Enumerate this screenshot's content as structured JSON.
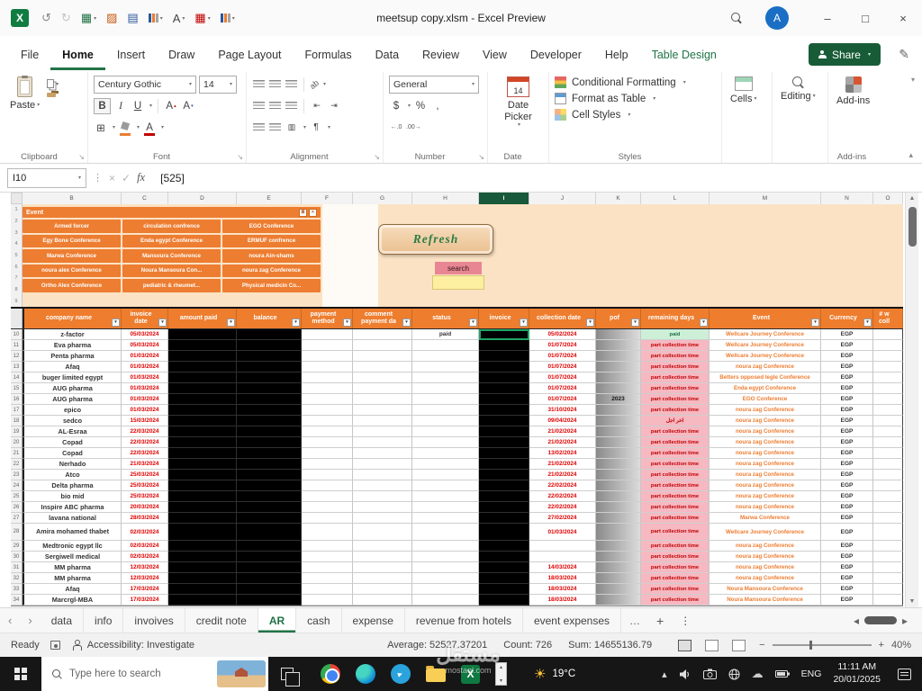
{
  "titlebar": {
    "title": "meetsup copy.xlsm - Excel Preview",
    "avatar_initial": "A",
    "qat": [
      {
        "id": "undo-icon",
        "caret": false
      },
      {
        "id": "redo-icon",
        "caret": false
      },
      {
        "id": "table-icon",
        "caret": true
      },
      {
        "id": "fill-icon",
        "caret": false
      },
      {
        "id": "grid-icon",
        "caret": false
      },
      {
        "id": "chart-icon",
        "caret": true
      },
      {
        "id": "font-icon",
        "caret": true
      },
      {
        "id": "calendar-icon",
        "caret": true
      },
      {
        "id": "chart-line-icon",
        "caret": true
      }
    ]
  },
  "ribbon": {
    "tabs": [
      "File",
      "Home",
      "Insert",
      "Draw",
      "Page Layout",
      "Formulas",
      "Data",
      "Review",
      "View",
      "Developer",
      "Help",
      "Table Design"
    ],
    "active_tab": "Home",
    "contextual_tab": "Table Design",
    "share_label": "Share",
    "paste_label": "Paste",
    "font_name": "Century Gothic",
    "font_size": "14",
    "number_format": "General",
    "calendar_day": "14",
    "date_picker_label": "Date Picker",
    "styles_buttons": [
      "Conditional Formatting",
      "Format as Table",
      "Cell Styles"
    ],
    "cells_label": "Cells",
    "editing_label": "Editing",
    "addins_label": "Add-ins",
    "group_labels": [
      "Clipboard",
      "Font",
      "Alignment",
      "Number",
      "Date",
      "Styles",
      "Add-ins"
    ]
  },
  "formula_bar": {
    "name_box": "I10",
    "value": "[525]"
  },
  "grid": {
    "column_letters": [
      "B",
      "C",
      "D",
      "E",
      "F",
      "G",
      "H",
      "I",
      "J",
      "K",
      "L",
      "M",
      "N",
      "O"
    ],
    "selected_letter": "I",
    "peach_row_numbers": [
      1,
      2,
      3,
      4,
      5,
      6,
      7,
      8,
      9
    ],
    "slicer": {
      "title": "Event",
      "items": [
        "Armed forcer",
        "circulation confrence",
        "EGO Conference",
        "Egy Bone Conference",
        "Enda egypt Conference",
        "ERMUF confrence",
        "Marwa Conference",
        "Mansoura Conference",
        "noura Ain-shams",
        "noura alex Conference",
        "Noura Mansoura Con...",
        "noura zag Conference",
        "Ortho Alex Conference",
        "pediatric & rheumet...",
        "Physical medicin Co..."
      ]
    },
    "refresh_label": "Refresh",
    "search_label": "search"
  },
  "table": {
    "headers": [
      "company name",
      "invoice date",
      "amount paid",
      "balance",
      "payment method",
      "comment payment da",
      "status",
      "invoice",
      "collection date",
      "pof",
      "remaining days",
      "Event",
      "Currency",
      "# w coll"
    ],
    "rows": [
      {
        "n": 10,
        "company": "z-factor",
        "date": "05/03/2024",
        "status": "paid",
        "coll": "05/02/2024",
        "pof": "",
        "rem": "paid",
        "rt": "g",
        "event": "Wellcare Journey Conference",
        "cur": "EGP",
        "sel": true
      },
      {
        "n": 11,
        "company": "Eva pharma",
        "date": "05/03/2024",
        "coll": "01/07/2024",
        "rem": "part collection time",
        "rt": "p",
        "event": "Wellcare Journey Conference",
        "cur": "EGP"
      },
      {
        "n": 12,
        "company": "Penta pharma",
        "date": "01/03/2024",
        "coll": "01/07/2024",
        "rem": "part collection time",
        "rt": "p",
        "event": "Wellcare Journey Conference",
        "cur": "EGP"
      },
      {
        "n": 13,
        "company": "Afaq",
        "date": "01/03/2024",
        "coll": "01/07/2024",
        "rem": "part collection time",
        "rt": "p",
        "event": "noura zag Conference",
        "cur": "EGP"
      },
      {
        "n": 14,
        "company": "buger limited egypt",
        "date": "01/03/2024",
        "coll": "01/07/2024",
        "rem": "part collection time",
        "rt": "p",
        "event": "Betters opposed legle Conference",
        "cur": "EGP"
      },
      {
        "n": 15,
        "company": "AUG pharma",
        "date": "01/03/2024",
        "coll": "01/07/2024",
        "rem": "part collection time",
        "rt": "p",
        "event": "Enda egypt Conference",
        "cur": "EGP"
      },
      {
        "n": 16,
        "company": "AUG pharma",
        "date": "01/03/2024",
        "coll": "01/07/2024",
        "pof": "2023",
        "rem": "part collection time",
        "rt": "p",
        "event": "EGO Conference",
        "cur": "EGP"
      },
      {
        "n": 17,
        "company": "epico",
        "date": "01/03/2024",
        "coll": "31/10/2024",
        "rem": "part collection time",
        "rt": "p",
        "event": "noura zag Conference",
        "cur": "EGP"
      },
      {
        "n": 18,
        "company": "sedco",
        "date": "15/03/2024",
        "coll": "09/04/2024",
        "rem": "اخر اجل",
        "rt": "p",
        "event": "noura zag Conference",
        "cur": "EGP"
      },
      {
        "n": 19,
        "company": "AL-Esraa",
        "date": "22/03/2024",
        "coll": "21/02/2024",
        "rem": "part collection time",
        "rt": "p",
        "event": "noura zag Conference",
        "cur": "EGP"
      },
      {
        "n": 20,
        "company": "Copad",
        "date": "22/03/2024",
        "coll": "21/02/2024",
        "rem": "part collection time",
        "rt": "p",
        "event": "noura zag Conference",
        "cur": "EGP"
      },
      {
        "n": 21,
        "company": "Copad",
        "date": "22/03/2024",
        "coll": "13/02/2024",
        "rem": "part collection time",
        "rt": "p",
        "event": "noura zag Conference",
        "cur": "EGP"
      },
      {
        "n": 22,
        "company": "Nerhado",
        "date": "21/03/2024",
        "coll": "21/02/2024",
        "rem": "part collection time",
        "rt": "p",
        "event": "noura zag Conference",
        "cur": "EGP"
      },
      {
        "n": 23,
        "company": "Atco",
        "date": "25/03/2024",
        "coll": "21/02/2024",
        "rem": "part collection time",
        "rt": "p",
        "event": "noura zag Conference",
        "cur": "EGP"
      },
      {
        "n": 24,
        "company": "Delta pharma",
        "date": "25/03/2024",
        "coll": "22/02/2024",
        "rem": "part collection time",
        "rt": "p",
        "event": "noura zag Conference",
        "cur": "EGP"
      },
      {
        "n": 25,
        "company": "bio mid",
        "date": "25/03/2024",
        "coll": "22/02/2024",
        "rem": "part collection time",
        "rt": "p",
        "event": "noura zag Conference",
        "cur": "EGP"
      },
      {
        "n": 26,
        "company": "Inspire ABC pharma",
        "date": "20/03/2024",
        "coll": "22/02/2024",
        "rem": "part collection time",
        "rt": "p",
        "event": "noura zag Conference",
        "cur": "EGP"
      },
      {
        "n": 27,
        "company": "lavana national",
        "date": "28/03/2024",
        "coll": "27/02/2024",
        "rem": "part collection time",
        "rt": "p",
        "event": "Marwa Conference",
        "cur": "EGP"
      },
      {
        "n": 28,
        "company": "Amira mohamed thabet",
        "date": "02/03/2024",
        "coll": "01/03/2024",
        "rem": "part collection time",
        "rt": "p",
        "event": "Wellcare Journey Conference",
        "cur": "EGP",
        "tall": true
      },
      {
        "n": 29,
        "company": "Medtronic egypt llc",
        "date": "02/03/2024",
        "coll": "",
        "rem": "part collection time",
        "rt": "p",
        "event": "noura zag Conference",
        "cur": "EGP"
      },
      {
        "n": 30,
        "company": "Sergiwell medical",
        "date": "02/03/2024",
        "coll": "",
        "rem": "part collection time",
        "rt": "p",
        "event": "noura zag Conference",
        "cur": "EGP"
      },
      {
        "n": 31,
        "company": "MM pharma",
        "date": "12/03/2024",
        "coll": "14/03/2024",
        "rem": "part collection time",
        "rt": "p",
        "event": "noura zag Conference",
        "cur": "EGP"
      },
      {
        "n": 32,
        "company": "MM pharma",
        "date": "12/03/2024",
        "coll": "18/03/2024",
        "rem": "part collection time",
        "rt": "p",
        "event": "noura zag Conference",
        "cur": "EGP"
      },
      {
        "n": 33,
        "company": "Afaq",
        "date": "17/03/2024",
        "coll": "18/03/2024",
        "rem": "part collection time",
        "rt": "p",
        "event": "Noura Mansoura Conference",
        "cur": "EGP"
      },
      {
        "n": 34,
        "company": "Marcrgl-MBA",
        "date": "17/03/2024",
        "coll": "18/03/2024",
        "rem": "part collection time",
        "rt": "p",
        "event": "Noura Mansoura Conference",
        "cur": "EGP"
      }
    ]
  },
  "sheet_tabs": {
    "tabs": [
      "data",
      "info",
      "invoives",
      "credit note",
      "AR",
      "cash",
      "expense",
      "revenue from hotels",
      "event expenses"
    ],
    "active": "AR",
    "more": "…",
    "add": "+",
    "kebab": "⋮"
  },
  "status_bar": {
    "mode": "Ready",
    "accessibility": "Accessibility: Investigate",
    "average": "Average: 52527.37201",
    "count": "Count: 726",
    "sum": "Sum: 14655136.79",
    "zoom": "40%"
  },
  "taskbar": {
    "search_placeholder": "Type here to search",
    "weather_temp": "19°C",
    "language": "ENG",
    "time": "11:11 AM",
    "date": "20/01/2025"
  },
  "watermark": {
    "text": "مستقل",
    "domain": "mostaql.com"
  },
  "colors": {
    "accent_orange": "#ED7D31",
    "excel_green": "#217346",
    "date_red": "#E00000",
    "paid_green_bg": "#CDEFD8",
    "pink_bg": "#F6B8C1"
  }
}
